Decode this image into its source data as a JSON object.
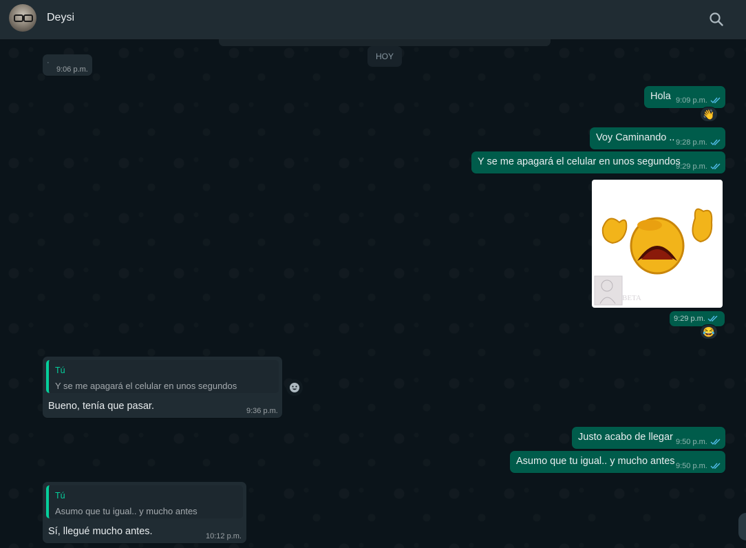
{
  "header": {
    "contact_name": "Deysi"
  },
  "icons": {
    "search": "search-icon",
    "avatar": "avatar",
    "emoji": "emoji-icon",
    "ticks": "double-check-icon"
  },
  "colors": {
    "outgoing": "#005c4b",
    "incoming": "#202c33",
    "accent": "#06cf9c",
    "read_ticks": "#53bdeb"
  },
  "chat": {
    "date_divider": "HOY",
    "messages": [
      {
        "direction": "in",
        "text": "·",
        "time": "9:06 p.m."
      },
      {
        "direction": "out",
        "text": "Hola",
        "time": "9:09 p.m.",
        "status": "read",
        "reaction": "👋"
      },
      {
        "direction": "out",
        "text": "Voy Caminando ..",
        "time": "9:28 p.m.",
        "status": "read"
      },
      {
        "direction": "out",
        "text": "Y se me apagará el celular en unos segundos",
        "time": "9:29 p.m.",
        "status": "read"
      },
      {
        "direction": "out",
        "type": "sticker",
        "sticker_caption": "BETA",
        "time": "9:29 p.m.",
        "status": "read",
        "reaction": "😂"
      },
      {
        "direction": "in",
        "quote_author": "Tú",
        "quote_text": "Y se me apagará el celular en unos segundos",
        "text": "Bueno, tenía que pasar.",
        "time": "9:36 p.m."
      },
      {
        "direction": "out",
        "text": "Justo acabo de llegar",
        "time": "9:50 p.m.",
        "status": "read"
      },
      {
        "direction": "out",
        "text": "Asumo que tu igual.. y mucho antes",
        "time": "9:50 p.m.",
        "status": "read"
      },
      {
        "direction": "in",
        "quote_author": "Tú",
        "quote_text": "Asumo que tu igual.. y mucho antes",
        "text": "Sí, llegué mucho antes.",
        "time": "10:12 p.m."
      }
    ]
  }
}
